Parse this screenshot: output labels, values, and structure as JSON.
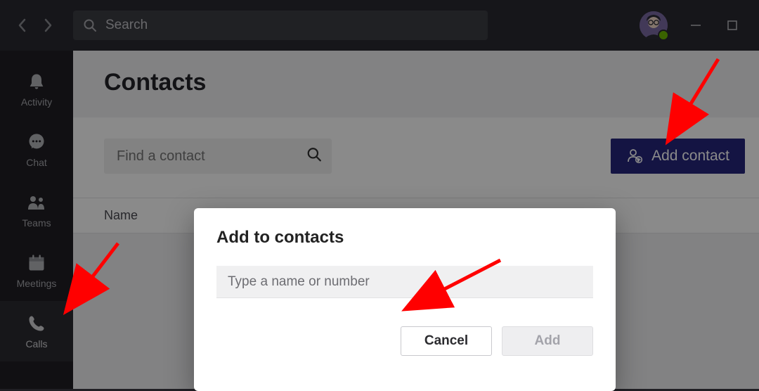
{
  "titlebar": {
    "search_placeholder": "Search"
  },
  "rail": {
    "items": [
      {
        "label": "Activity"
      },
      {
        "label": "Chat"
      },
      {
        "label": "Teams"
      },
      {
        "label": "Meetings"
      },
      {
        "label": "Calls"
      }
    ]
  },
  "page": {
    "title": "Contacts",
    "find_placeholder": "Find a contact",
    "add_contact_label": "Add contact",
    "columns": {
      "name": "Name"
    }
  },
  "modal": {
    "title": "Add to contacts",
    "input_placeholder": "Type a name or number",
    "cancel_label": "Cancel",
    "add_label": "Add"
  }
}
